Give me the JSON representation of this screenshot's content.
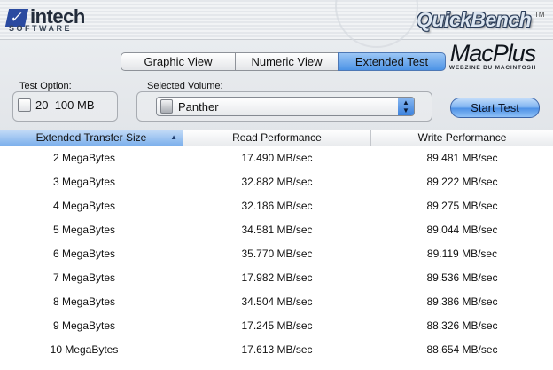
{
  "logo": {
    "name": "intech",
    "subtitle": "SOFTWARE"
  },
  "app": {
    "title": "QuickBench",
    "tm": "TM"
  },
  "tabs": [
    {
      "label": "Graphic View",
      "active": false
    },
    {
      "label": "Numeric View",
      "active": false
    },
    {
      "label": "Extended Test",
      "active": true
    }
  ],
  "macplus": {
    "title": "MacPlus",
    "subtitle": "WEBZINE DU MACINTOSH"
  },
  "test_option": {
    "label": "Test Option:",
    "checkbox_label": "20–100 MB",
    "checked": false
  },
  "volume": {
    "label": "Selected Volume:",
    "value": "Panther"
  },
  "start_button": "Start Test",
  "table": {
    "columns": [
      "Extended Transfer Size",
      "Read Performance",
      "Write Performance"
    ],
    "sorted_column": 0,
    "rows": [
      [
        "2 MegaBytes",
        "17.490 MB/sec",
        "89.481 MB/sec"
      ],
      [
        "3 MegaBytes",
        "32.882 MB/sec",
        "89.222 MB/sec"
      ],
      [
        "4 MegaBytes",
        "32.186 MB/sec",
        "89.275 MB/sec"
      ],
      [
        "5 MegaBytes",
        "34.581 MB/sec",
        "89.044 MB/sec"
      ],
      [
        "6 MegaBytes",
        "35.770 MB/sec",
        "89.119 MB/sec"
      ],
      [
        "7 MegaBytes",
        "17.982 MB/sec",
        "89.536 MB/sec"
      ],
      [
        "8 MegaBytes",
        "34.504 MB/sec",
        "89.386 MB/sec"
      ],
      [
        "9 MegaBytes",
        "17.245 MB/sec",
        "88.326 MB/sec"
      ],
      [
        "10 MegaBytes",
        "17.613 MB/sec",
        "88.654 MB/sec"
      ]
    ]
  }
}
